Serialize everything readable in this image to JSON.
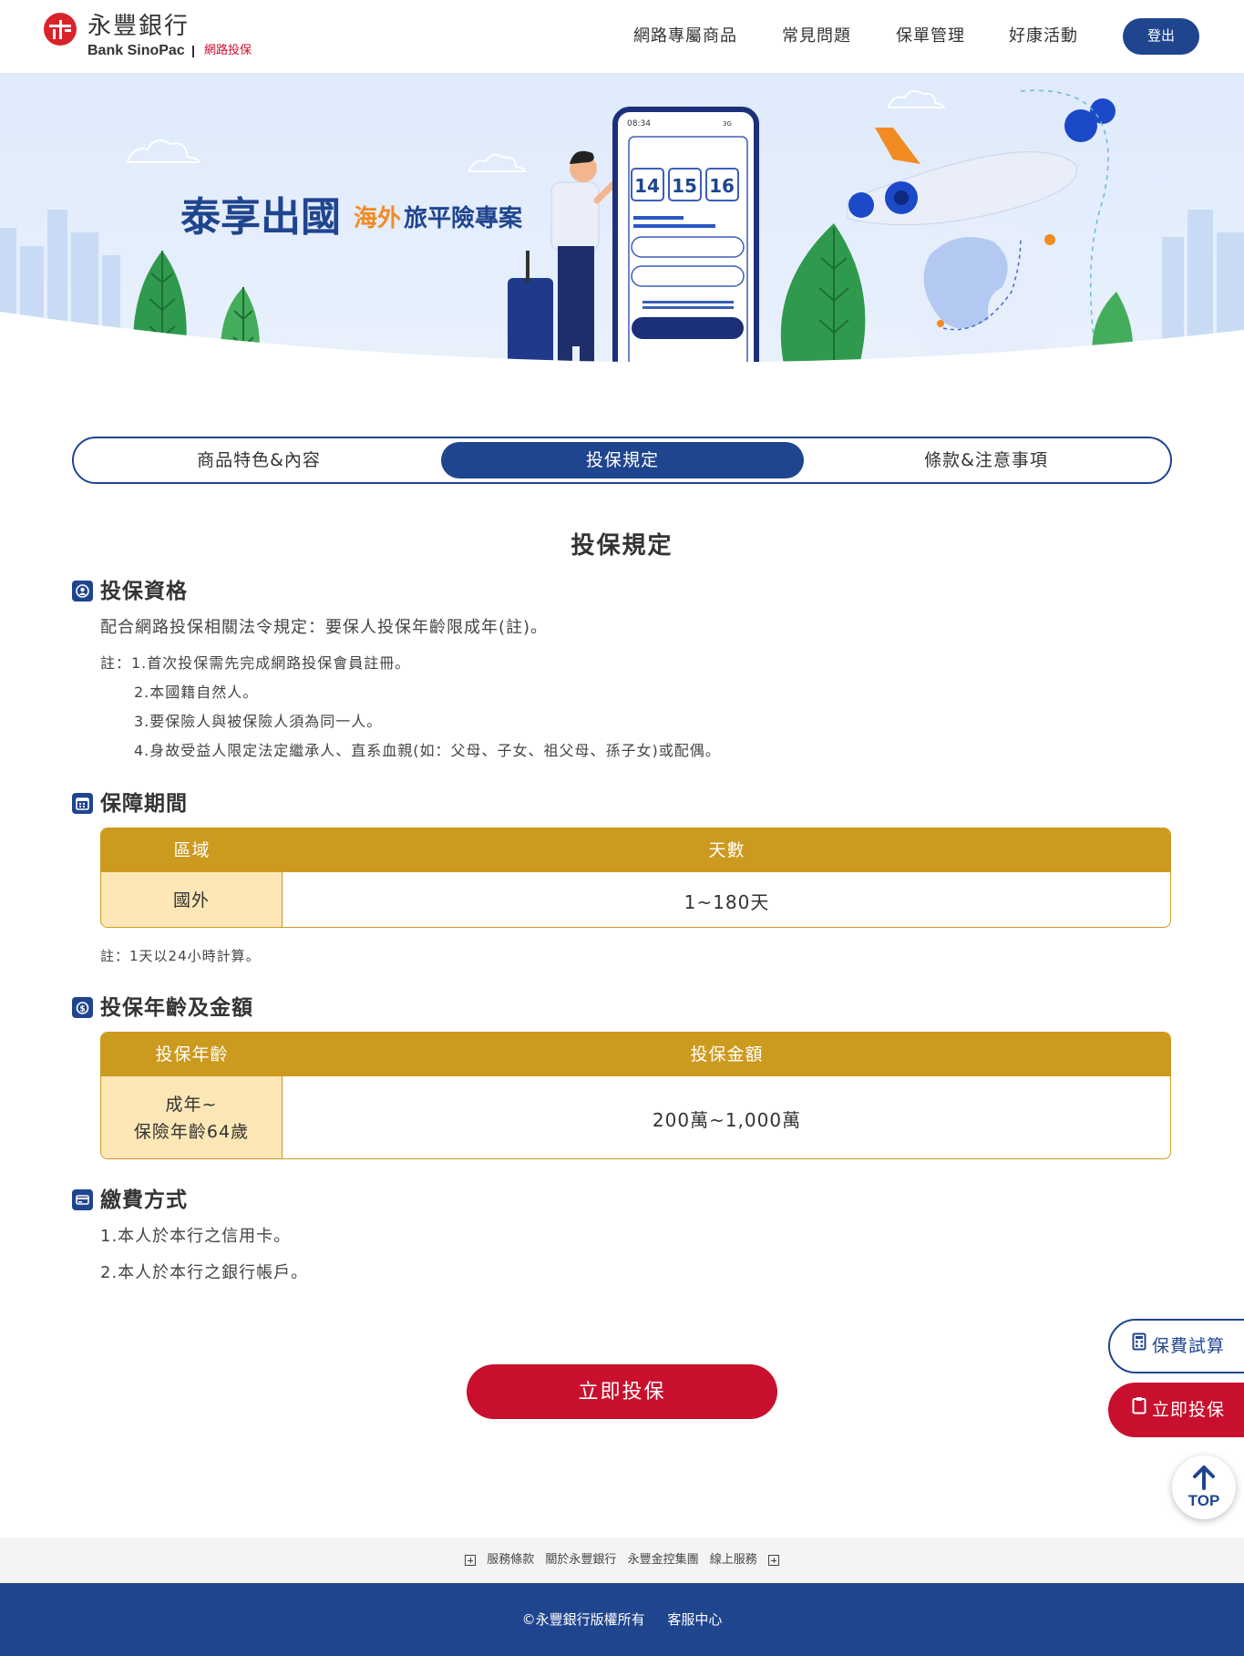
{
  "header": {
    "logo_zh": "永豐銀行",
    "logo_en": "Bank SinoPac",
    "logo_sub": "網路投保",
    "nav": [
      "網路專屬商品",
      "常見問題",
      "保單管理",
      "好康活動"
    ],
    "logout": "登出"
  },
  "banner": {
    "title": "泰享出國",
    "subtitle_accent": "海外",
    "subtitle": "旅平險專案",
    "phone_time": "08:34",
    "phone_signal": "3G",
    "dates": [
      "14",
      "15",
      "16"
    ]
  },
  "tabs": [
    "商品特色&內容",
    "投保規定",
    "條款&注意事項"
  ],
  "page_title": "投保規定",
  "eligibility": {
    "title": "投保資格",
    "text": "配合網路投保相關法令規定：要保人投保年齡限成年(註)。",
    "notes": [
      "註：1.首次投保需先完成網路投保會員註冊。",
      "2.本國籍自然人。",
      "3.要保險人與被保險人須為同一人。",
      "4.身故受益人限定法定繼承人、直系血親(如：父母、子女、祖父母、孫子女)或配偶。"
    ]
  },
  "period": {
    "title": "保障期間",
    "headers": [
      "區域",
      "天數"
    ],
    "rows": [
      [
        "國外",
        "1~180天"
      ]
    ],
    "note": "註：1天以24小時計算。"
  },
  "age_amount": {
    "title": "投保年齡及金額",
    "headers": [
      "投保年齡",
      "投保金額"
    ],
    "row_age": [
      "成年~",
      "保險年齡64歲"
    ],
    "row_amount": "200萬~1,000萬"
  },
  "payment": {
    "title": "繳費方式",
    "items": [
      "1.本人於本行之信用卡。",
      "2.本人於本行之銀行帳戶。"
    ]
  },
  "cta": "立即投保",
  "floating": {
    "quote": "保費試算",
    "buy": "立即投保",
    "top": "TOP"
  },
  "footer": {
    "links": [
      "服務條款",
      "關於永豐銀行",
      "永豐金控集團",
      "線上服務"
    ],
    "copyright": "©永豐銀行版權所有",
    "service": "客服中心"
  },
  "colors": {
    "primary": "#20458f",
    "accent_red": "#c8102e",
    "gold": "#cc9a1f",
    "gold_light": "#fde7b6",
    "orange": "#f28b22"
  }
}
